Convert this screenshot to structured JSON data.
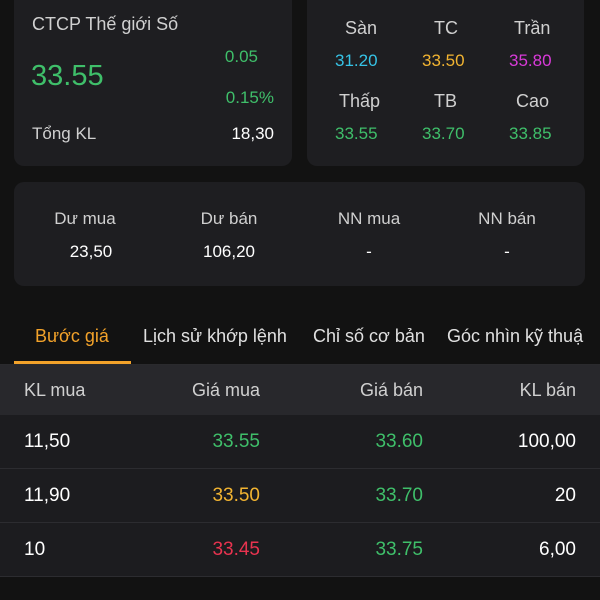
{
  "quote": {
    "company": "CTCP Thế giới Số",
    "price": "33.55",
    "change": "0.05",
    "change_pct": "0.15%",
    "volume_label": "Tổng KL",
    "volume_value": "18,30"
  },
  "ref_prices": {
    "floor_label": "Sàn",
    "floor_value": "31.20",
    "ref_label": "TC",
    "ref_value": "33.50",
    "ceil_label": "Trần",
    "ceil_value": "35.80",
    "low_label": "Thấp",
    "low_value": "33.55",
    "avg_label": "TB",
    "avg_value": "33.70",
    "high_label": "Cao",
    "high_value": "33.85"
  },
  "orders_summary": {
    "buy_label": "Dư mua",
    "buy_value": "23,50",
    "sell_label": "Dư bán",
    "sell_value": "106,20",
    "foreign_buy_label": "NN mua",
    "foreign_buy_value": "-",
    "foreign_sell_label": "NN bán",
    "foreign_sell_value": "-"
  },
  "tabs": [
    {
      "label": "Bước giá",
      "active": true
    },
    {
      "label": "Lịch sử khớp lệnh",
      "active": false
    },
    {
      "label": "Chỉ số cơ bản",
      "active": false
    },
    {
      "label": "Góc nhìn kỹ thuậ",
      "active": false
    }
  ],
  "order_book": {
    "headers": [
      "KL mua",
      "Giá mua",
      "Giá bán",
      "KL bán"
    ],
    "rows": [
      {
        "bid_vol": "11,50",
        "bid_price": "33.55",
        "ask_price": "33.60",
        "ask_vol": "100,00"
      },
      {
        "bid_vol": "11,90",
        "bid_price": "33.50",
        "ask_price": "33.70",
        "ask_vol": "20"
      },
      {
        "bid_vol": "10",
        "bid_price": "33.45",
        "ask_price": "33.75",
        "ask_vol": "6,00"
      }
    ]
  },
  "colors": {
    "up": "#3fbf6a",
    "ref": "#f2b431",
    "floor": "#36c3e6",
    "ceil": "#d93ad9",
    "down": "#e8334f",
    "accent": "#f2a22a"
  }
}
